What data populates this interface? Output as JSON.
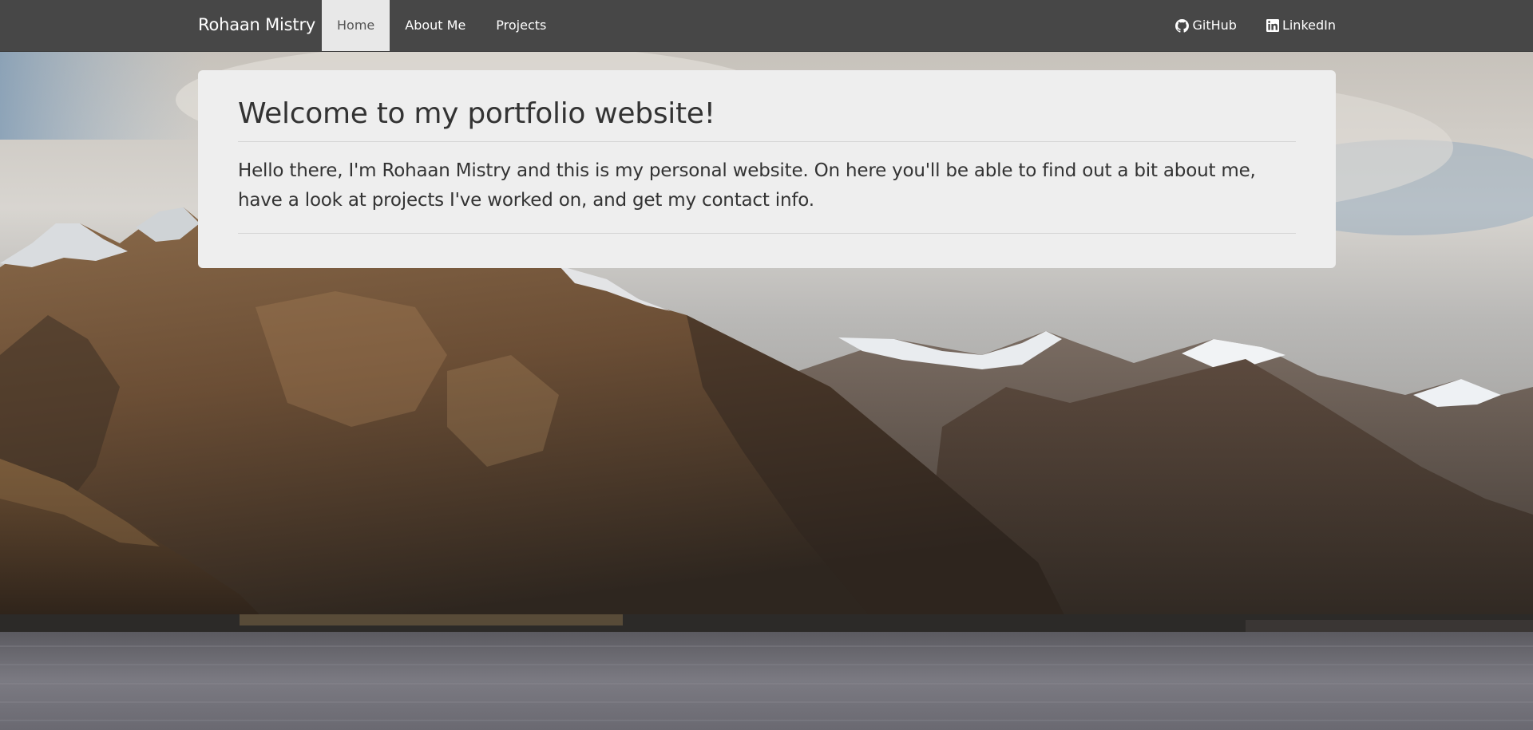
{
  "nav": {
    "brand": "Rohaan Mistry",
    "links": [
      {
        "label": "Home",
        "active": true
      },
      {
        "label": "About Me",
        "active": false
      },
      {
        "label": "Projects",
        "active": false
      }
    ],
    "social": [
      {
        "label": "GitHub",
        "icon": "github-icon"
      },
      {
        "label": "LinkedIn",
        "icon": "linkedin-icon"
      }
    ]
  },
  "jumbotron": {
    "title": "Welcome to my portfolio website!",
    "text": "Hello there, I'm Rohaan Mistry and this is my personal website. On here you'll be able to find out a bit about me, have a look at projects I've worked on, and get my contact info."
  },
  "colors": {
    "navbar_bg": "#474747",
    "active_tab_bg": "#e8e8e8",
    "card_bg": "#eeeeee",
    "text": "#333333"
  }
}
